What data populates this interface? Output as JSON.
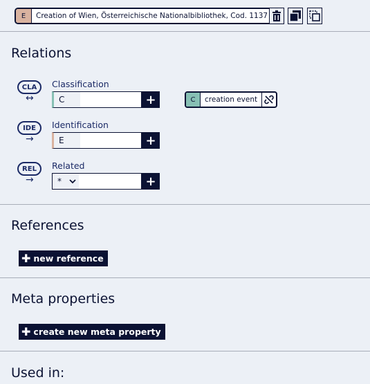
{
  "header": {
    "entity_letter": "E",
    "entity_title": "Creation of Wien, Österreichische Nationalbibliothek, Cod. 1137",
    "delete_icon": "trash-icon",
    "copy_icon": "copy-icon",
    "select_icon": "select-copy-icon"
  },
  "relations": {
    "heading": "Relations",
    "rows": [
      {
        "badge": "CLA",
        "arrow": "↔",
        "label": "Classification",
        "value": "C",
        "add": "+"
      },
      {
        "badge": "IDE",
        "arrow": "→",
        "label": "Identification",
        "value": "E",
        "add": "+"
      },
      {
        "badge": "REL",
        "arrow": "→",
        "label": "Related",
        "value": "*",
        "add": "+"
      }
    ],
    "linked_chip": {
      "letter": "C",
      "label": "creation event"
    }
  },
  "references": {
    "heading": "References",
    "button_label": "new reference"
  },
  "meta": {
    "heading": "Meta properties",
    "button_label": "create new meta property"
  },
  "used_in": {
    "heading": "Used in:"
  },
  "colors": {
    "navy": "#0b1233",
    "entity_E": "#d9b29f",
    "entity_C": "#87c0b4",
    "background": "#ecf0f6"
  }
}
